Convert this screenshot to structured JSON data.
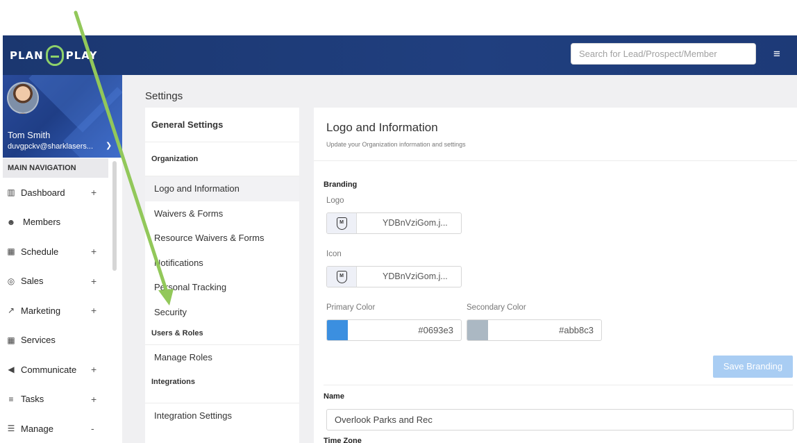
{
  "app": {
    "brand_left": "PLAN",
    "brand_right": "PLAY",
    "search_placeholder": "Search for Lead/Prospect/Member",
    "menu_icon": "hamburger-icon"
  },
  "user": {
    "name": "Tom Smith",
    "email": "duvgpckv@sharklasers..."
  },
  "sidebar": {
    "heading": "MAIN NAVIGATION",
    "items": [
      {
        "label": "Dashboard",
        "icon": "chart-icon",
        "toggle": "+"
      },
      {
        "label": "Members",
        "icon": "users-icon",
        "toggle": ""
      },
      {
        "label": "Schedule",
        "icon": "calendar-icon",
        "toggle": "+"
      },
      {
        "label": "Sales",
        "icon": "target-icon",
        "toggle": "+"
      },
      {
        "label": "Marketing",
        "icon": "trend-icon",
        "toggle": "+"
      },
      {
        "label": "Services",
        "icon": "grid-icon",
        "toggle": ""
      },
      {
        "label": "Communicate",
        "icon": "megaphone-icon",
        "toggle": "+"
      },
      {
        "label": "Tasks",
        "icon": "list-icon",
        "toggle": "+"
      },
      {
        "label": "Manage",
        "icon": "menu-lines-icon",
        "toggle": "-"
      }
    ]
  },
  "page": {
    "title": "Settings"
  },
  "settings_menu": {
    "heading": "General Settings",
    "sections": {
      "organization": "Organization",
      "users_roles": "Users & Roles",
      "integrations": "Integrations"
    },
    "org_items": [
      "Logo and Information",
      "Waivers & Forms",
      "Resource Waivers & Forms",
      "Notifications",
      "Personal Tracking",
      "Security"
    ],
    "user_items": [
      "Manage Roles"
    ],
    "integration_items": [
      "Integration Settings"
    ]
  },
  "panel": {
    "title": "Logo and Information",
    "subtitle": "Update your Organization information and settings",
    "branding_label": "Branding",
    "logo_label": "Logo",
    "logo_file": "YDBnVziGom.j...",
    "icon_label": "Icon",
    "icon_file": "YDBnVziGom.j...",
    "primary_label": "Primary Color",
    "primary_value": "#0693e3",
    "primary_swatch": "#3b8fe0",
    "secondary_label": "Secondary Color",
    "secondary_value": "#abb8c3",
    "secondary_swatch": "#abb8c3",
    "save_label": "Save Branding",
    "name_label": "Name",
    "name_value": "Overlook Parks and Rec",
    "timezone_label": "Time Zone"
  },
  "colors": {
    "topbar": "#1f3c7b",
    "accent_green": "#8ed16a",
    "annotation_arrow": "#92c85a"
  }
}
